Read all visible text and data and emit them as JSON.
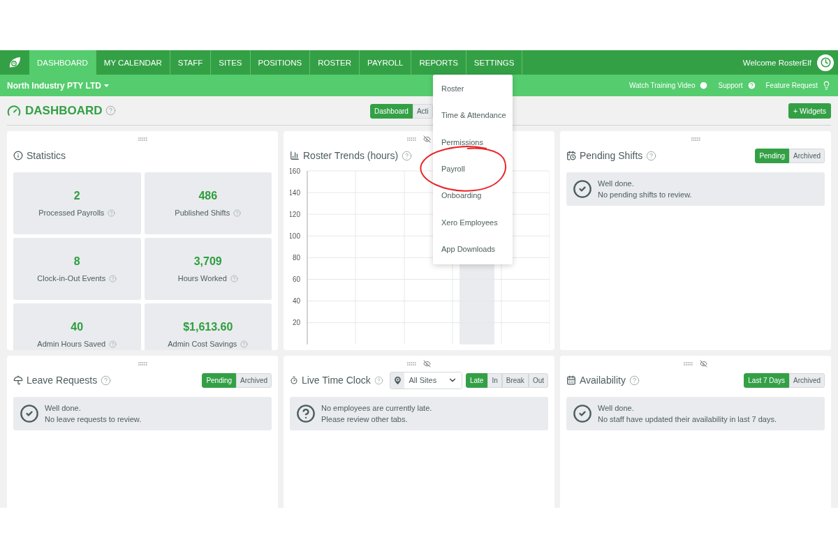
{
  "nav": {
    "tabs": [
      {
        "label": "DASHBOARD",
        "selected": true
      },
      {
        "label": "MY CALENDAR",
        "selected": false
      },
      {
        "label": "STAFF",
        "selected": false
      },
      {
        "label": "SITES",
        "selected": false
      },
      {
        "label": "POSITIONS",
        "selected": false
      },
      {
        "label": "ROSTER",
        "selected": false
      },
      {
        "label": "PAYROLL",
        "selected": false
      },
      {
        "label": "REPORTS",
        "selected": false
      },
      {
        "label": "SETTINGS",
        "selected": false
      }
    ],
    "welcome": "Welcome RosterElf"
  },
  "company_bar": {
    "company": "North Industry PTY LTD",
    "links": [
      "Watch Training Video",
      "Support",
      "Feature Request"
    ]
  },
  "header": {
    "title": "DASHBOARD",
    "views": [
      {
        "label": "Dashboard",
        "selected": true
      },
      {
        "label": "Acti",
        "selected": false
      }
    ],
    "widgets_button": "+ Widgets"
  },
  "settings_menu": {
    "items": [
      {
        "label": "Roster",
        "annotated": false
      },
      {
        "label": "Time & Attendance",
        "annotated": false
      },
      {
        "label": "Permissions",
        "annotated": false
      },
      {
        "label": "Payroll",
        "annotated": true
      },
      {
        "label": "Onboarding",
        "annotated": false
      },
      {
        "label": "Xero Employees",
        "annotated": false
      },
      {
        "label": "App Downloads",
        "annotated": false
      }
    ]
  },
  "widgets": [
    {
      "kind": "statistics",
      "title": "Statistics",
      "hideable": false,
      "stats": [
        {
          "value": "2",
          "label": "Processed Payrolls"
        },
        {
          "value": "486",
          "label": "Published Shifts"
        },
        {
          "value": "8",
          "label": "Clock-in-Out Events"
        },
        {
          "value": "3,709",
          "label": "Hours Worked"
        },
        {
          "value": "40",
          "label": "Admin Hours Saved"
        },
        {
          "value": "$1,613.60",
          "label": "Admin Cost Savings"
        }
      ]
    },
    {
      "kind": "chart",
      "title": "Roster Trends (hours)",
      "hideable": true,
      "axis_labels": [
        "160",
        "140",
        "120",
        "100",
        "80",
        "60",
        "40",
        "20"
      ]
    },
    {
      "kind": "list",
      "title": "Pending Shifts",
      "hideable": false,
      "filters": [
        {
          "label": "Pending",
          "selected": true
        },
        {
          "label": "Archived",
          "selected": false
        }
      ],
      "message": {
        "kind": "done",
        "lines": [
          "Well done.",
          "No pending shifts to review."
        ]
      }
    },
    {
      "kind": "list",
      "title": "Leave Requests",
      "hideable": false,
      "filters": [
        {
          "label": "Pending",
          "selected": true
        },
        {
          "label": "Archived",
          "selected": false
        }
      ],
      "message": {
        "kind": "done",
        "lines": [
          "Well done.",
          "No leave requests to review."
        ]
      }
    },
    {
      "kind": "live_clock",
      "title": "Live Time Clock",
      "hideable": true,
      "site": "All Sites",
      "filters": [
        {
          "label": "Late",
          "selected": true
        },
        {
          "label": "In",
          "selected": false
        },
        {
          "label": "Break",
          "selected": false
        },
        {
          "label": "Out",
          "selected": false
        }
      ],
      "message": {
        "kind": "question",
        "lines": [
          "No employees are currently late.",
          "Please review other tabs."
        ]
      }
    },
    {
      "kind": "list",
      "title": "Availability",
      "hideable": true,
      "filters": [
        {
          "label": "Last 7 Days",
          "selected": true
        },
        {
          "label": "Archived",
          "selected": false
        }
      ],
      "message": {
        "kind": "done",
        "lines": [
          "Well done.",
          "No staff have updated their availability in last 7 days."
        ]
      }
    }
  ]
}
